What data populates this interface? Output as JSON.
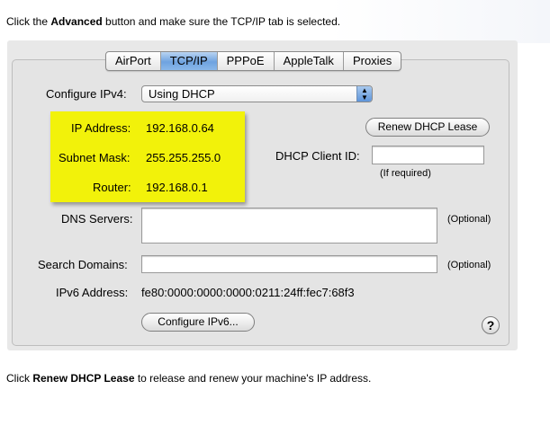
{
  "instructions": {
    "top_pre": "Click the ",
    "top_bold": "Advanced",
    "top_post": " button and make sure the TCP/IP tab is selected.",
    "bottom_pre": "Click ",
    "bottom_bold": "Renew DHCP Lease",
    "bottom_post": " to release and renew your machine's IP address."
  },
  "tabs": [
    "AirPort",
    "TCP/IP",
    "PPPoE",
    "AppleTalk",
    "Proxies"
  ],
  "selected_tab": "TCP/IP",
  "configure_ipv4": {
    "label": "Configure IPv4:",
    "value": "Using DHCP"
  },
  "ip_info": {
    "ip_label": "IP Address:",
    "ip_value": "192.168.0.64",
    "subnet_label": "Subnet Mask:",
    "subnet_value": "255.255.255.0",
    "router_label": "Router:",
    "router_value": "192.168.0.1"
  },
  "renew_button": "Renew DHCP Lease",
  "dhcp_client_id": {
    "label": "DHCP Client ID:",
    "value": "",
    "note": "(If required)"
  },
  "dns": {
    "label": "DNS Servers:",
    "value": "",
    "note": "(Optional)"
  },
  "search_domains": {
    "label": "Search Domains:",
    "value": "",
    "note": "(Optional)"
  },
  "ipv6": {
    "label": "IPv6 Address:",
    "value": "fe80:0000:0000:0000:0211:24ff:fec7:68f3"
  },
  "configure_ipv6_button": "Configure IPv6...",
  "help_glyph": "?",
  "colors": {
    "highlight": "#f2f20a",
    "selected_tab": "#6fa3e0"
  }
}
